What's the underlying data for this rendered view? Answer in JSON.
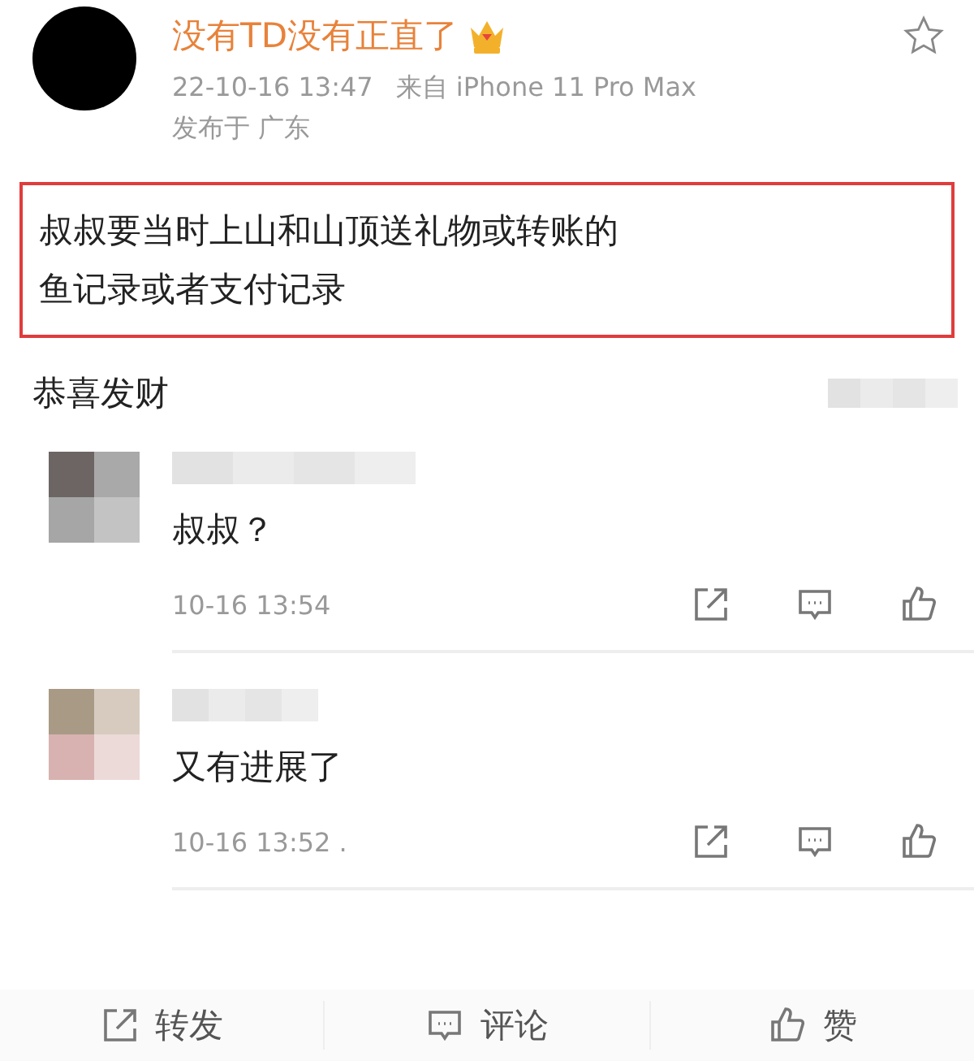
{
  "post": {
    "author": "没有TD没有正直了",
    "time": "22-10-16 13:47",
    "source": "来自 iPhone 11 Pro Max",
    "location": "发布于 广东",
    "highlighted_lines": [
      "叔叔要当时上山和山顶送礼物或转账的",
      "鱼记录或者支付记录"
    ],
    "favorited": false
  },
  "reply_preview": "恭喜发财",
  "comments": [
    {
      "text": "叔叔？",
      "time": "10-16 13:54"
    },
    {
      "text": "又有进展了",
      "time": "10-16 13:52 ."
    }
  ],
  "actions": [
    {
      "kind": "repost",
      "label": "转发"
    },
    {
      "kind": "comment",
      "label": "评论"
    },
    {
      "kind": "like",
      "label": "赞"
    }
  ]
}
